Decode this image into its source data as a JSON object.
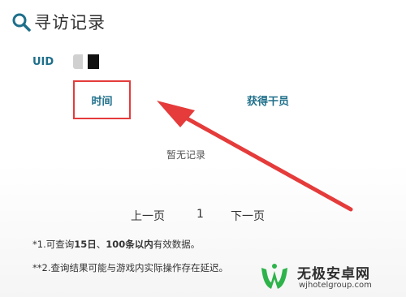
{
  "header": {
    "title": "寻访记录",
    "icon": "search-icon"
  },
  "uid": {
    "label": "UID"
  },
  "columns": {
    "time": "时间",
    "gained": "获得干员"
  },
  "empty_state": "暂无记录",
  "pagination": {
    "prev": "上一页",
    "page": "1",
    "next": "下一页"
  },
  "notes": {
    "note1": {
      "prefix": "*1.可查询",
      "days": "15日",
      "sep": "、",
      "count": "100条以内",
      "suffix": "有效数据。"
    },
    "note2": "**2.查询结果可能与游戏内实际操作存在延迟。"
  },
  "watermark": {
    "title": "无极安卓网",
    "url": "wjhotelgroup.com"
  },
  "colors": {
    "accent": "#1e6f8a",
    "highlight_box": "#e53b3b",
    "arrow": "#e53b3b",
    "logo_green": "#2db34a"
  }
}
